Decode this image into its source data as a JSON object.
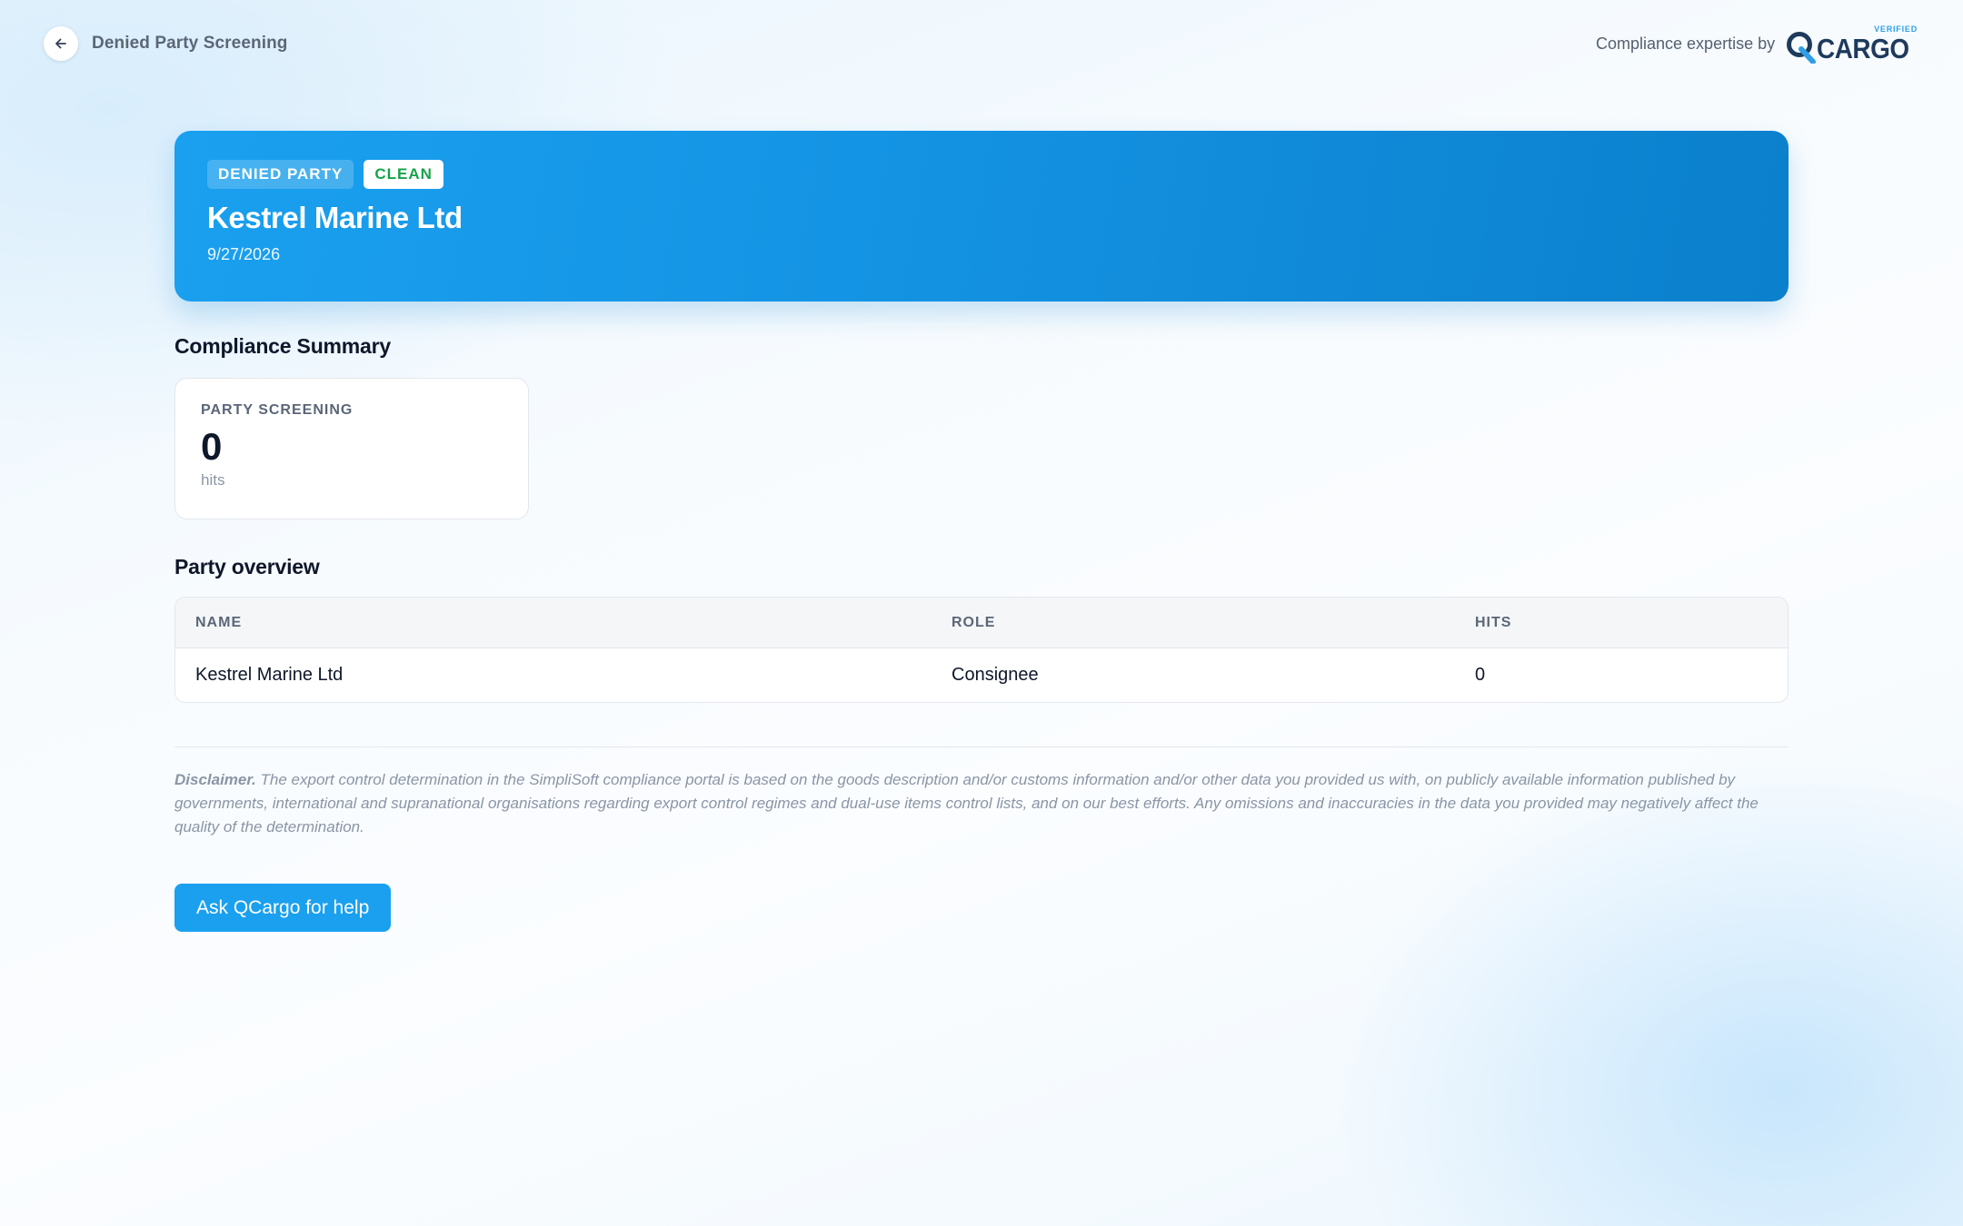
{
  "header": {
    "title": "Denied Party Screening",
    "back_icon": "arrow-left-icon",
    "expertise_text": "Compliance expertise by",
    "brand": {
      "verified": "VERIFIED",
      "name": "CARGO",
      "q_icon": "qcargo-q-logo-icon"
    }
  },
  "hero": {
    "type_badge": "DENIED PARTY",
    "status_badge": "CLEAN",
    "title": "Kestrel Marine Ltd",
    "date": "9/27/2026",
    "status_color": "#16a34a",
    "accent_color": "#1aa0ef"
  },
  "summary": {
    "heading": "Compliance Summary",
    "metric": {
      "label": "PARTY SCREENING",
      "value": "0",
      "unit": "hits"
    }
  },
  "overview": {
    "heading": "Party overview",
    "columns": [
      "NAME",
      "ROLE",
      "HITS"
    ],
    "rows": [
      [
        "Kestrel Marine Ltd",
        "Consignee",
        "0"
      ]
    ]
  },
  "disclaimer": {
    "label": "Disclaimer.",
    "text": "The export control determination in the SimpliSoft compliance portal is based on the goods description and/or customs information and/or other data you provided us with, on publicly available information published by governments, international and supranational organisations regarding export control regimes and dual-use items control lists, and on our best efforts. Any omissions and inaccuracies in the data you provided may negatively affect the quality of the determination."
  },
  "actions": {
    "help_label": "Ask QCargo for help"
  }
}
